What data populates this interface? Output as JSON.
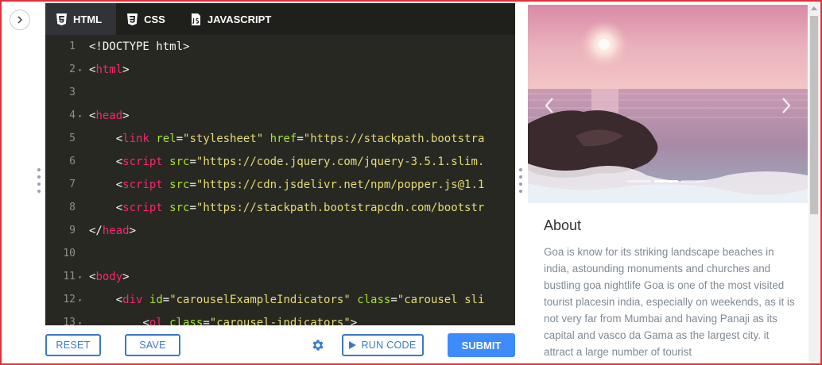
{
  "tabs": [
    {
      "label": "HTML",
      "icon": "html5-icon",
      "active": true
    },
    {
      "label": "CSS",
      "icon": "css3-icon",
      "active": false
    },
    {
      "label": "JAVASCRIPT",
      "icon": "js-file-icon",
      "active": false
    }
  ],
  "code_lines": [
    {
      "num": "1",
      "fold": false,
      "indent": 0,
      "tokens": [
        [
          "p",
          "<!DOCTYPE html>"
        ]
      ]
    },
    {
      "num": "2",
      "fold": true,
      "indent": 0,
      "tokens": [
        [
          "p",
          "<"
        ],
        [
          "t",
          "html"
        ],
        [
          "p",
          ">"
        ]
      ]
    },
    {
      "num": "3",
      "fold": false,
      "indent": 0,
      "tokens": []
    },
    {
      "num": "4",
      "fold": true,
      "indent": 0,
      "tokens": [
        [
          "p",
          "<"
        ],
        [
          "t",
          "head"
        ],
        [
          "p",
          ">"
        ]
      ]
    },
    {
      "num": "5",
      "fold": false,
      "indent": 1,
      "tokens": [
        [
          "p",
          "<"
        ],
        [
          "t",
          "link"
        ],
        [
          "p",
          " "
        ],
        [
          "a",
          "rel"
        ],
        [
          "p",
          "="
        ],
        [
          "s",
          "\"stylesheet\""
        ],
        [
          "p",
          " "
        ],
        [
          "a",
          "href"
        ],
        [
          "p",
          "="
        ],
        [
          "s",
          "\"https://stackpath.bootstra"
        ]
      ]
    },
    {
      "num": "6",
      "fold": false,
      "indent": 1,
      "tokens": [
        [
          "p",
          "<"
        ],
        [
          "t",
          "script"
        ],
        [
          "p",
          " "
        ],
        [
          "a",
          "src"
        ],
        [
          "p",
          "="
        ],
        [
          "s",
          "\"https://code.jquery.com/jquery-3.5.1.slim."
        ]
      ]
    },
    {
      "num": "7",
      "fold": false,
      "indent": 1,
      "tokens": [
        [
          "p",
          "<"
        ],
        [
          "t",
          "script"
        ],
        [
          "p",
          " "
        ],
        [
          "a",
          "src"
        ],
        [
          "p",
          "="
        ],
        [
          "s",
          "\"https://cdn.jsdelivr.net/npm/popper.js@1.1"
        ]
      ]
    },
    {
      "num": "8",
      "fold": false,
      "indent": 1,
      "tokens": [
        [
          "p",
          "<"
        ],
        [
          "t",
          "script"
        ],
        [
          "p",
          " "
        ],
        [
          "a",
          "src"
        ],
        [
          "p",
          "="
        ],
        [
          "s",
          "\"https://stackpath.bootstrapcdn.com/bootstr"
        ]
      ]
    },
    {
      "num": "9",
      "fold": false,
      "indent": 0,
      "tokens": [
        [
          "p",
          "</"
        ],
        [
          "t",
          "head"
        ],
        [
          "p",
          ">"
        ]
      ]
    },
    {
      "num": "10",
      "fold": false,
      "indent": 0,
      "tokens": []
    },
    {
      "num": "11",
      "fold": true,
      "indent": 0,
      "tokens": [
        [
          "p",
          "<"
        ],
        [
          "t",
          "body"
        ],
        [
          "p",
          ">"
        ]
      ]
    },
    {
      "num": "12",
      "fold": true,
      "indent": 1,
      "tokens": [
        [
          "p",
          "<"
        ],
        [
          "t",
          "div"
        ],
        [
          "p",
          " "
        ],
        [
          "a",
          "id"
        ],
        [
          "p",
          "="
        ],
        [
          "s",
          "\"carouselExampleIndicators\""
        ],
        [
          "p",
          " "
        ],
        [
          "a",
          "class"
        ],
        [
          "p",
          "="
        ],
        [
          "s",
          "\"carousel sli"
        ]
      ]
    },
    {
      "num": "13",
      "fold": true,
      "indent": 2,
      "tokens": [
        [
          "p",
          "<"
        ],
        [
          "t",
          "ol"
        ],
        [
          "p",
          " "
        ],
        [
          "a",
          "class"
        ],
        [
          "p",
          "="
        ],
        [
          "s",
          "\"carousel-indicators\""
        ],
        [
          "p",
          ">"
        ]
      ]
    }
  ],
  "toolbar": {
    "reset_label": "RESET",
    "save_label": "SAVE",
    "settings_icon": "gear-icon",
    "run_label": "RUN CODE",
    "submit_label": "SUBMIT"
  },
  "preview": {
    "card_title": "About",
    "card_text": "Goa is know for its striking landscape beaches in india, astounding monuments and churches and bustling goa nightlife Goa is one of the most visited tourist placesin india, especially on weekends, as it is not very far from Mumbai and having Panaji as its capital and vasco da Gama as the largest city. it attract a large number of tourist",
    "carousel_slide_count": 3,
    "carousel_active_index": 1
  },
  "colors": {
    "editor_bg": "#272822",
    "accent": "#3a78c9",
    "submit_bg": "#3d8bfd",
    "tag": "#f92672",
    "attr": "#a6e22e",
    "string": "#e6db74"
  }
}
